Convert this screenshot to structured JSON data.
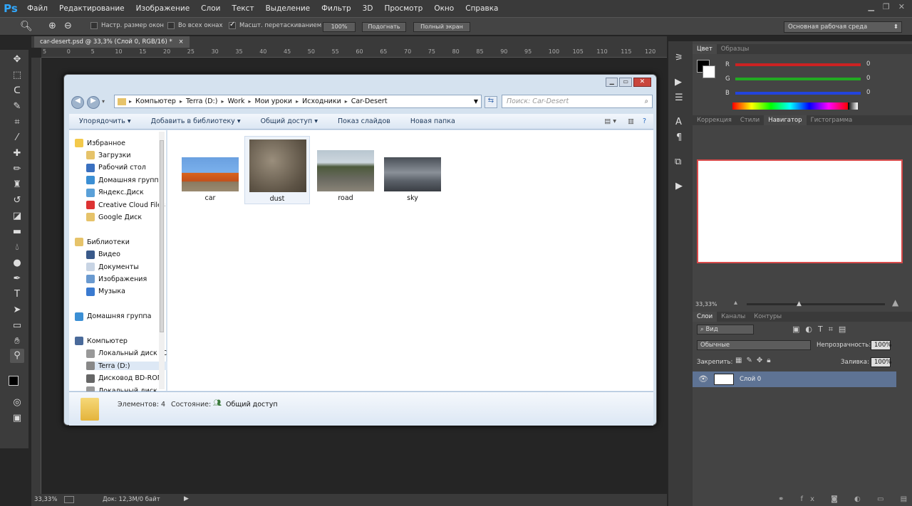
{
  "menubar": {
    "logo": "Ps",
    "items": [
      "Файл",
      "Редактирование",
      "Изображение",
      "Слои",
      "Текст",
      "Выделение",
      "Фильтр",
      "3D",
      "Просмотр",
      "Окно",
      "Справка"
    ]
  },
  "options": {
    "resize_windows": "Настр. размер окон",
    "all_windows": "Во всех окнах",
    "scrubby_zoom": "Масшт. перетаскиванием",
    "zoom100": "100%",
    "fit": "Подогнать",
    "full_screen": "Полный экран",
    "workspace": "Основная рабочая среда"
  },
  "document": {
    "tab": "car-desert.psd @ 33,3% (Слой 0, RGB/16) *",
    "zoom": "33,33%",
    "doc_size": "Док: 12,3М/0 байт"
  },
  "ruler_ticks": [
    "5",
    "0",
    "5",
    "10",
    "15",
    "20",
    "25",
    "30",
    "35",
    "40",
    "45",
    "50",
    "55",
    "60",
    "65",
    "70",
    "75",
    "80",
    "85",
    "90",
    "95",
    "100",
    "105",
    "110",
    "115",
    "120"
  ],
  "color_panel": {
    "tabs": [
      "Цвет",
      "Образцы"
    ],
    "channels": [
      {
        "label": "R",
        "value": "0",
        "color": "#cc2222"
      },
      {
        "label": "G",
        "value": "0",
        "color": "#22aa22"
      },
      {
        "label": "B",
        "value": "0",
        "color": "#2244dd"
      }
    ]
  },
  "nav_panel": {
    "tabs": [
      "Коррекция",
      "Стили",
      "Навигатор",
      "Гистограмма"
    ],
    "zoom": "33,33%"
  },
  "layers_panel": {
    "tabs": [
      "Слои",
      "Каналы",
      "Контуры"
    ],
    "filter": "Вид",
    "blend": "Обычные",
    "opacity_label": "Непрозрачность:",
    "opacity": "100%",
    "lock_label": "Закрепить:",
    "fill_label": "Заливка:",
    "fill": "100%",
    "layer_name": "Слой 0"
  },
  "explorer": {
    "breadcrumbs": [
      "Компьютер",
      "Terra (D:)",
      "Work",
      "Мои уроки",
      "Исходники",
      "Car-Desert"
    ],
    "search_placeholder": "Поиск: Car-Desert",
    "commands": [
      "Упорядочить ▾",
      "Добавить в библиотеку ▾",
      "Общий доступ ▾",
      "Показ слайдов",
      "Новая папка"
    ],
    "nav": [
      {
        "label": "Избранное",
        "indent": 0,
        "color": "#f3c94b"
      },
      {
        "label": "Загрузки",
        "indent": 1,
        "color": "#e6c36a"
      },
      {
        "label": "Рабочий стол",
        "indent": 1,
        "color": "#3a70c0"
      },
      {
        "label": "Домашняя группа",
        "indent": 1,
        "color": "#3b8fd4"
      },
      {
        "label": "Яндекс.Диск",
        "indent": 1,
        "color": "#5aa0d8"
      },
      {
        "label": "Creative Cloud Files",
        "indent": 1,
        "color": "#d33"
      },
      {
        "label": "Google Диск",
        "indent": 1,
        "color": "#e6c36a"
      },
      {
        "label": "",
        "indent": 0,
        "color": ""
      },
      {
        "label": "Библиотеки",
        "indent": 0,
        "color": "#e6c36a"
      },
      {
        "label": "Видео",
        "indent": 1,
        "color": "#3a5a8a"
      },
      {
        "label": "Документы",
        "indent": 1,
        "color": "#c8d4e4"
      },
      {
        "label": "Изображения",
        "indent": 1,
        "color": "#6a9ad0"
      },
      {
        "label": "Музыка",
        "indent": 1,
        "color": "#3a7ad0"
      },
      {
        "label": "",
        "indent": 0,
        "color": ""
      },
      {
        "label": "Домашняя группа",
        "indent": 0,
        "color": "#3b8fd4"
      },
      {
        "label": "",
        "indent": 0,
        "color": ""
      },
      {
        "label": "Компьютер",
        "indent": 0,
        "color": "#4a6a9a"
      },
      {
        "label": "Локальный диск (C:)",
        "indent": 1,
        "color": "#999"
      },
      {
        "label": "Terra (D:)",
        "indent": 1,
        "color": "#888"
      },
      {
        "label": "Дисковод BD-ROM",
        "indent": 1,
        "color": "#666"
      },
      {
        "label": "Локальный диск",
        "indent": 1,
        "color": "#999"
      }
    ],
    "files": [
      {
        "name": "car",
        "bg": "linear-gradient(#6aa0e0 0%,#7ab0ec 45%,#d8631c 46%,#c4501a 70%,#8a7a60 72%,#9a8a70 100%)"
      },
      {
        "name": "dust",
        "bg": "radial-gradient(circle at 40% 40%,#9a8e7c,#5e5446 70%,#4a4236)"
      },
      {
        "name": "road",
        "bg": "linear-gradient(#b8c6d0 0%,#cdd7de 30%,#4d5a3c 40%,#6a6a60 70%,#8a8478 100%)"
      },
      {
        "name": "sky",
        "bg": "linear-gradient(#4a5058 0%,#8a9098 45%,#5a6068 70%,#3a3e44 100%)"
      }
    ],
    "status_count": "Элементов: 4",
    "status_state": "Состояние:",
    "status_share": "Общий доступ"
  }
}
